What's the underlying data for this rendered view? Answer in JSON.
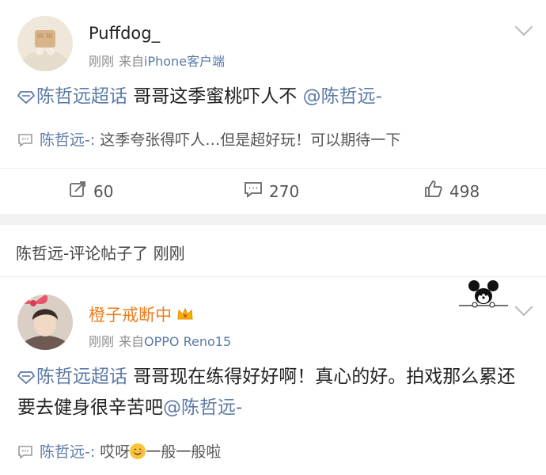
{
  "post1": {
    "username": "Puffdog_",
    "time": "刚刚",
    "source_prefix": "来自",
    "source": "iPhone客户端",
    "topic": "陈哲远超话",
    "text": " 哥哥这季蜜桃吓人不",
    "mention": "@陈哲远-",
    "reply_name": "陈哲远-:",
    "reply_text": " 这季夸张得吓人…但是超好玩！可以期待一下",
    "repost_count": "60",
    "comment_count": "270",
    "like_count": "498"
  },
  "notice": {
    "text": "陈哲远-评论帖子了 刚刚"
  },
  "post2": {
    "username": "橙子戒断中",
    "time": "刚刚",
    "source_prefix": "来自",
    "source": "OPPO Reno15",
    "topic": "陈哲远超话",
    "text": " 哥哥现在练得好好啊！真心的好。拍戏那么累还要去健身很辛苦吧",
    "mention": "@陈哲远-",
    "reply_name": "陈哲远-:",
    "reply_text_before": " 哎呀",
    "reply_text_after": "一般一般啦"
  },
  "icons": {
    "topic": "diamond-topic-icon",
    "reply": "comment-bubble-icon",
    "repost": "repost-icon",
    "comment": "comment-icon",
    "like": "thumbs-up-icon",
    "chevron": "chevron-down-icon",
    "crown": "crown-badge-icon",
    "decoration": "mickey-mouse-decoration"
  },
  "colors": {
    "link": "#5b7aa6",
    "vip_name": "#f07c1a",
    "meta": "#8c8c8c"
  }
}
